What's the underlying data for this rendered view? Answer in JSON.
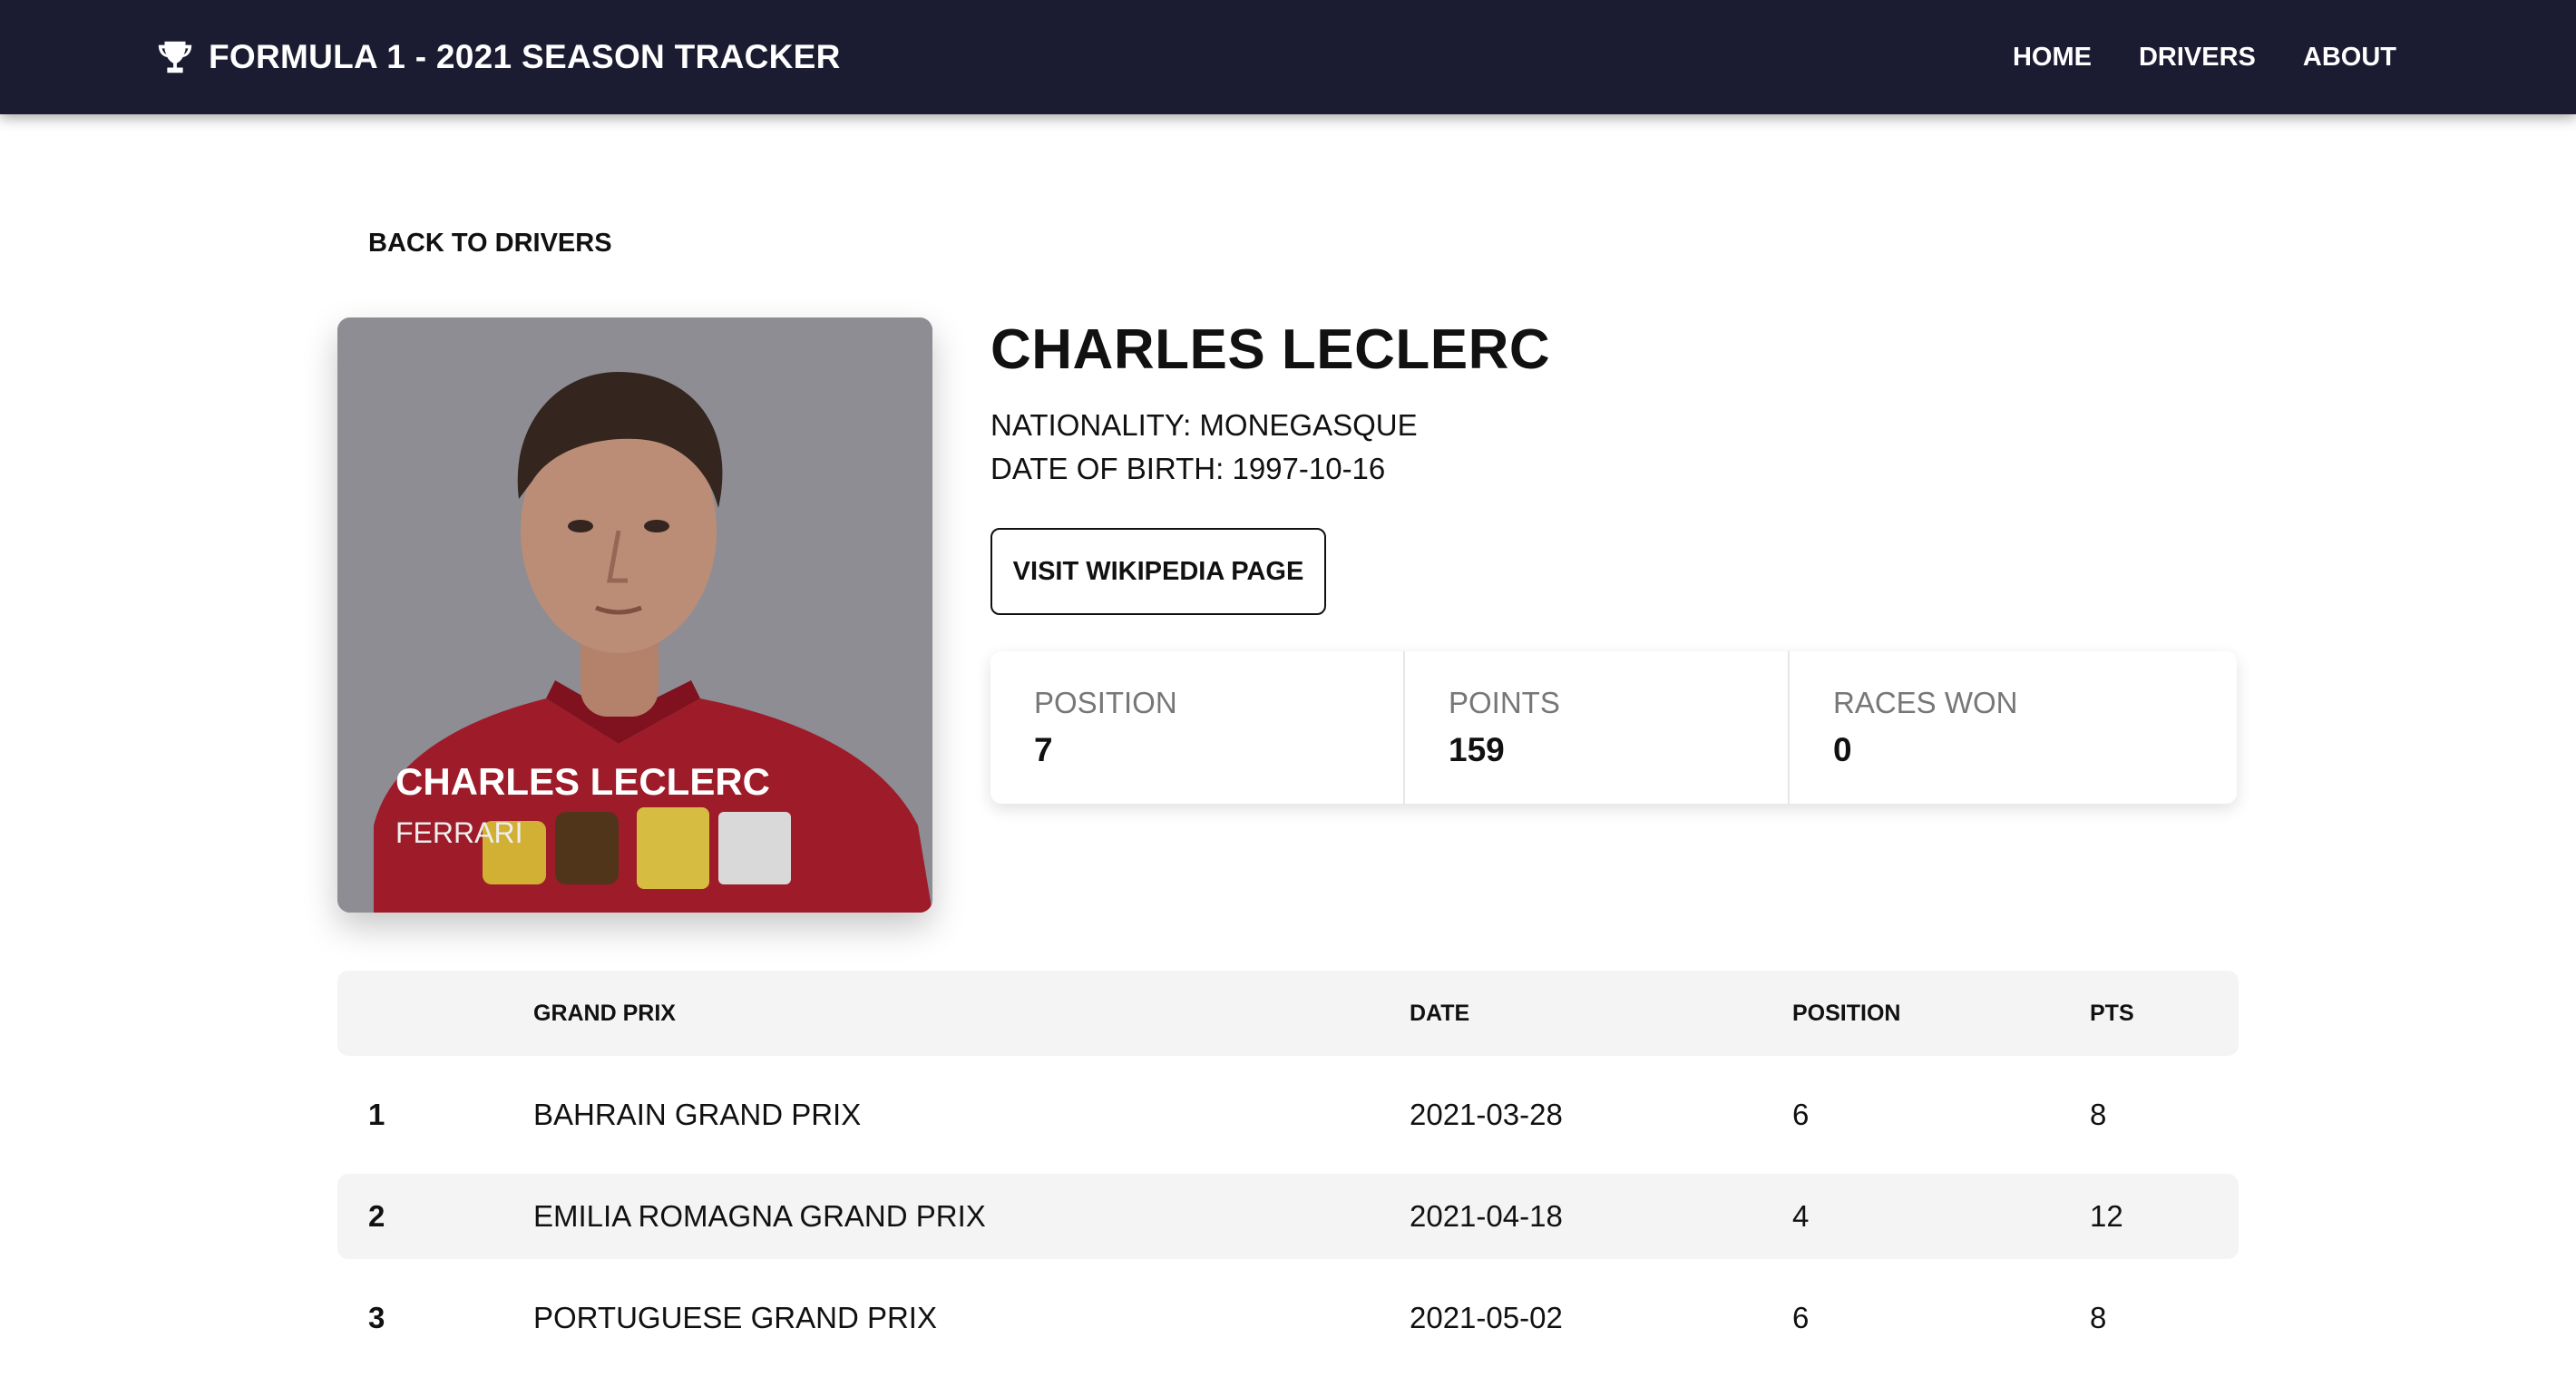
{
  "navbar": {
    "brand": "FORMULA 1 - 2021 SEASON TRACKER",
    "brand_icon": "trophy-icon",
    "links": [
      "HOME",
      "DRIVERS",
      "ABOUT"
    ]
  },
  "back_link": "BACK TO DRIVERS",
  "photo_card": {
    "name": "CHARLES LECLERC",
    "team": "FERRARI"
  },
  "driver": {
    "name": "CHARLES LECLERC",
    "nationality": "NATIONALITY: MONEGASQUE",
    "date_of_birth": "DATE OF BIRTH: 1997-10-16",
    "wiki_button": "VISIT WIKIPEDIA PAGE"
  },
  "stats": [
    {
      "label": "POSITION",
      "value": "7"
    },
    {
      "label": "POINTS",
      "value": "159"
    },
    {
      "label": "RACES WON",
      "value": "0"
    }
  ],
  "results": {
    "headers": [
      "",
      "GRAND PRIX",
      "DATE",
      "POSITION",
      "PTS"
    ],
    "rows": [
      {
        "round": "1",
        "grand_prix": "BAHRAIN GRAND PRIX",
        "date": "2021-03-28",
        "position": "6",
        "pts": "8"
      },
      {
        "round": "2",
        "grand_prix": "EMILIA ROMAGNA GRAND PRIX",
        "date": "2021-04-18",
        "position": "4",
        "pts": "12"
      },
      {
        "round": "3",
        "grand_prix": "PORTUGUESE GRAND PRIX",
        "date": "2021-05-02",
        "position": "6",
        "pts": "8"
      }
    ]
  },
  "colors": {
    "navbar_bg": "#1b1b32",
    "table_row_shade": "#f4f4f4",
    "suit_red": "#c8102e"
  }
}
